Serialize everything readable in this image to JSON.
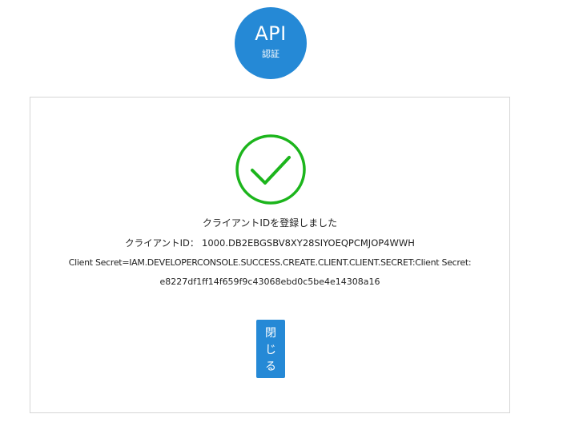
{
  "badge": {
    "title": "API",
    "subtitle": "認証"
  },
  "result": {
    "message": "クライアントIDを登録しました",
    "client_id_line": "クライアントID：  1000.DB2EBGSBV8XY28SIYOEQPCMJOP4WWH",
    "client_secret_line": "Client Secret=IAM.DEVELOPERCONSOLE.SUCCESS.CREATE.CLIENT.CLIENT.SECRET:Client Secret:",
    "client_secret_value": "e8227df1ff14f659f9c43068ebd0c5be4e14308a16"
  },
  "close_button": {
    "chars": [
      "閉",
      "じ",
      "る"
    ]
  },
  "colors": {
    "accent": "#2589d6",
    "success": "#1cb51c",
    "panel_border": "#d6d6d6"
  },
  "icons": {
    "success": "checkmark-circle-icon"
  }
}
